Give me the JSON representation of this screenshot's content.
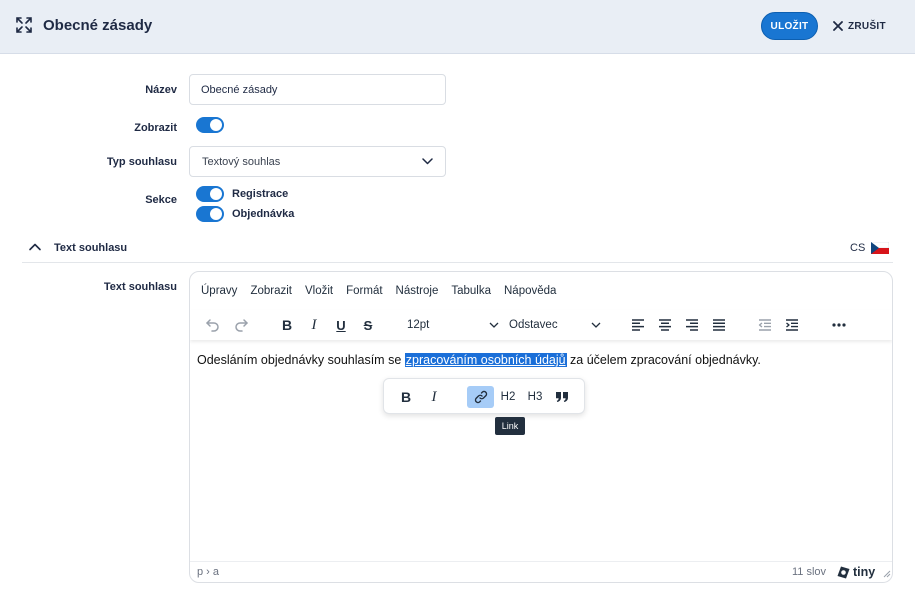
{
  "header": {
    "title": "Obecné zásady",
    "save_label": "ULOŽIT",
    "cancel_label": "ZRUŠIT",
    "accent_color": "#1976d2"
  },
  "form": {
    "name_label": "Název",
    "name_value": "Obecné zásady",
    "display_label": "Zobrazit",
    "display_on": true,
    "type_label": "Typ souhlasu",
    "type_value": "Textový souhlas",
    "sections_label": "Sekce",
    "sections": [
      {
        "label": "Registrace",
        "on": true
      },
      {
        "label": "Objednávka",
        "on": true
      }
    ]
  },
  "text_section": {
    "title": "Text souhlasu",
    "language_code": "CS",
    "flag_icon": "czech-flag-icon",
    "field_label": "Text souhlasu"
  },
  "editor": {
    "menu": [
      "Úpravy",
      "Zobrazit",
      "Vložit",
      "Formát",
      "Nástroje",
      "Tabulka",
      "Nápověda"
    ],
    "font_size": "12pt",
    "block_format": "Odstavec",
    "content_before": "Odesláním objednávky souhlasím se ",
    "content_link": "zpracováním osobních údajů",
    "content_after": " za účelem zpracování objednávky.",
    "quickbar": {
      "h2": "H2",
      "h3": "H3"
    },
    "tooltip": "Link",
    "path": "p › a",
    "word_count": "11 slov",
    "brand": "tiny"
  }
}
